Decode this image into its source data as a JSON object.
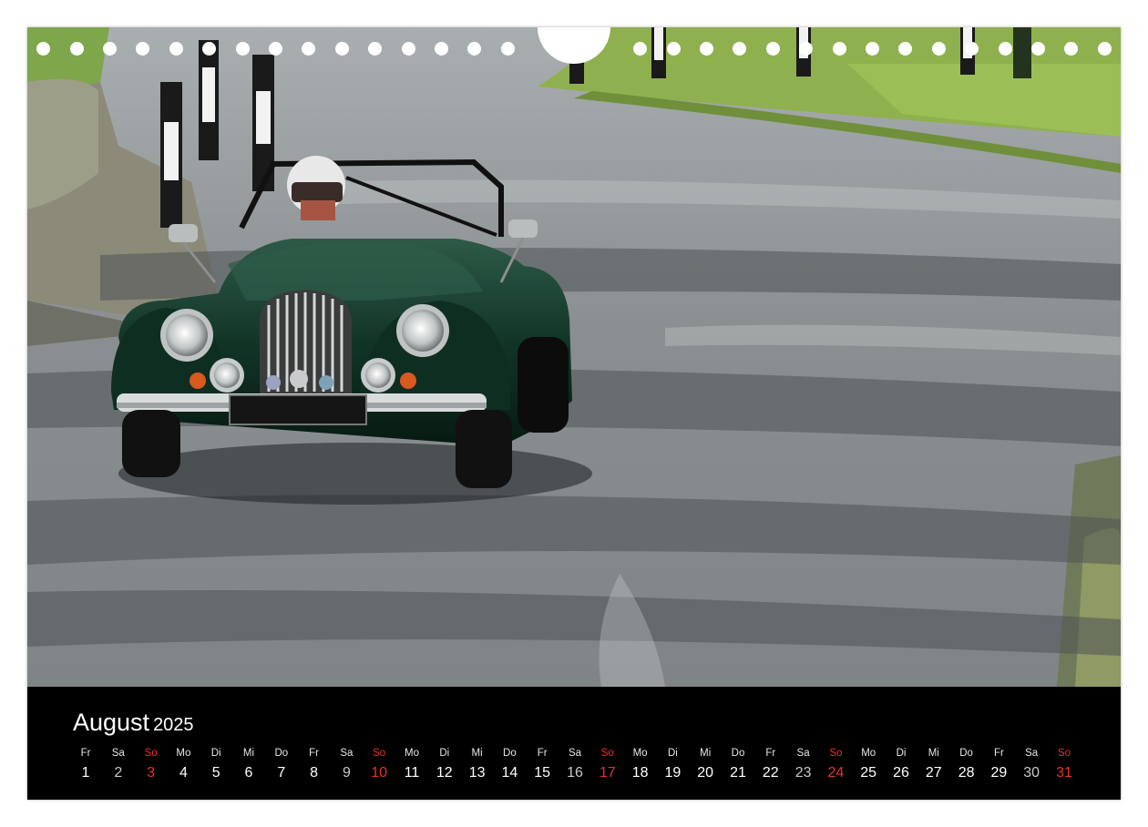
{
  "calendar": {
    "month": "August",
    "year": "2025",
    "days": [
      {
        "dow": "Fr",
        "num": "1"
      },
      {
        "dow": "Sa",
        "num": "2"
      },
      {
        "dow": "So",
        "num": "3"
      },
      {
        "dow": "Mo",
        "num": "4"
      },
      {
        "dow": "Di",
        "num": "5"
      },
      {
        "dow": "Mi",
        "num": "6"
      },
      {
        "dow": "Do",
        "num": "7"
      },
      {
        "dow": "Fr",
        "num": "8"
      },
      {
        "dow": "Sa",
        "num": "9"
      },
      {
        "dow": "So",
        "num": "10"
      },
      {
        "dow": "Mo",
        "num": "11"
      },
      {
        "dow": "Di",
        "num": "12"
      },
      {
        "dow": "Mi",
        "num": "13"
      },
      {
        "dow": "Do",
        "num": "14"
      },
      {
        "dow": "Fr",
        "num": "15"
      },
      {
        "dow": "Sa",
        "num": "16"
      },
      {
        "dow": "So",
        "num": "17"
      },
      {
        "dow": "Mo",
        "num": "18"
      },
      {
        "dow": "Di",
        "num": "19"
      },
      {
        "dow": "Mi",
        "num": "20"
      },
      {
        "dow": "Do",
        "num": "21"
      },
      {
        "dow": "Fr",
        "num": "22"
      },
      {
        "dow": "Sa",
        "num": "23"
      },
      {
        "dow": "So",
        "num": "24"
      },
      {
        "dow": "Mo",
        "num": "25"
      },
      {
        "dow": "Di",
        "num": "26"
      },
      {
        "dow": "Mi",
        "num": "27"
      },
      {
        "dow": "Do",
        "num": "28"
      },
      {
        "dow": "Fr",
        "num": "29"
      },
      {
        "dow": "Sa",
        "num": "30"
      },
      {
        "dow": "So",
        "num": "31"
      }
    ]
  },
  "colors": {
    "background": "#000000",
    "sunday": "#e8322c",
    "car_body": "#123528",
    "grass": "#8fb04e"
  }
}
